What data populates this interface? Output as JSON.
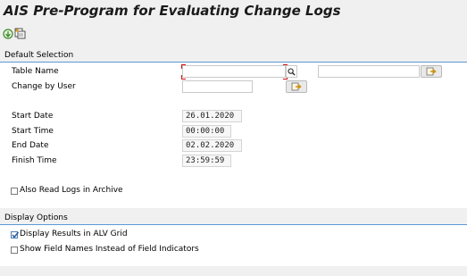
{
  "window": {
    "title": "AIS Pre-Program for Evaluating Change Logs"
  },
  "toolbar": {
    "execute_icon": "execute-icon",
    "variant_icon": "get-variant-icon"
  },
  "default_selection": {
    "section_title": "Default Selection",
    "table_name": {
      "label": "Table Name",
      "value": "",
      "to_value": ""
    },
    "change_by_user": {
      "label": "Change by User",
      "value": ""
    },
    "start_date": {
      "label": "Start Date",
      "value": "26.01.2020"
    },
    "start_time": {
      "label": "Start Time",
      "value": "00:00:00"
    },
    "end_date": {
      "label": "End Date",
      "value": "02.02.2020"
    },
    "finish_time": {
      "label": "Finish Time",
      "value": "23:59:59"
    },
    "archive": {
      "label": "Also Read Logs in Archive",
      "checked": false
    }
  },
  "display_options": {
    "section_title": "Display Options",
    "alv_grid": {
      "label": "Display Results in ALV Grid",
      "checked": true
    },
    "field_names": {
      "label": "Show Field Names Instead of Field Indicators",
      "checked": false
    }
  },
  "colors": {
    "section_line": "#5a9ad6",
    "required_marker": "#d01010",
    "accent_arrow": "#e0a020"
  }
}
